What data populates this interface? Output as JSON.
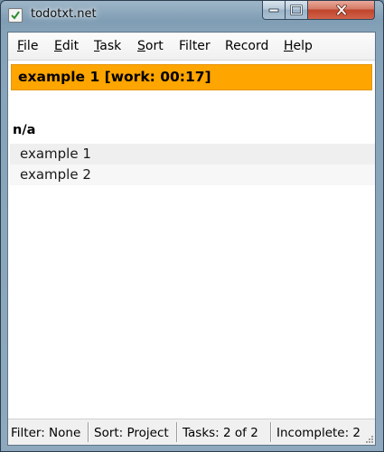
{
  "window": {
    "title": "todotxt.net",
    "app_icon": "checkbox-icon",
    "buttons": {
      "minimize": "minimize-icon",
      "maximize": "maximize-icon",
      "close": "close-icon"
    }
  },
  "menu": {
    "items": [
      {
        "accel": "F",
        "rest": "ile"
      },
      {
        "accel": "E",
        "rest": "dit"
      },
      {
        "accel": "T",
        "rest": "ask"
      },
      {
        "accel": "S",
        "rest": "ort"
      },
      {
        "accel": "",
        "rest": "Filter"
      },
      {
        "accel": "",
        "rest": "Record"
      },
      {
        "accel": "H",
        "rest": "elp"
      }
    ]
  },
  "active_task": {
    "text": "example 1 [work: 00:17]",
    "color": "#ffa500"
  },
  "group": {
    "header": "n/a"
  },
  "tasks": [
    {
      "text": "example 1"
    },
    {
      "text": "example 2"
    }
  ],
  "status": {
    "filter": "Filter: None",
    "sort": "Sort:  Project",
    "tasks": "Tasks:  2  of  2",
    "incomplete": "Incomplete:  2"
  }
}
